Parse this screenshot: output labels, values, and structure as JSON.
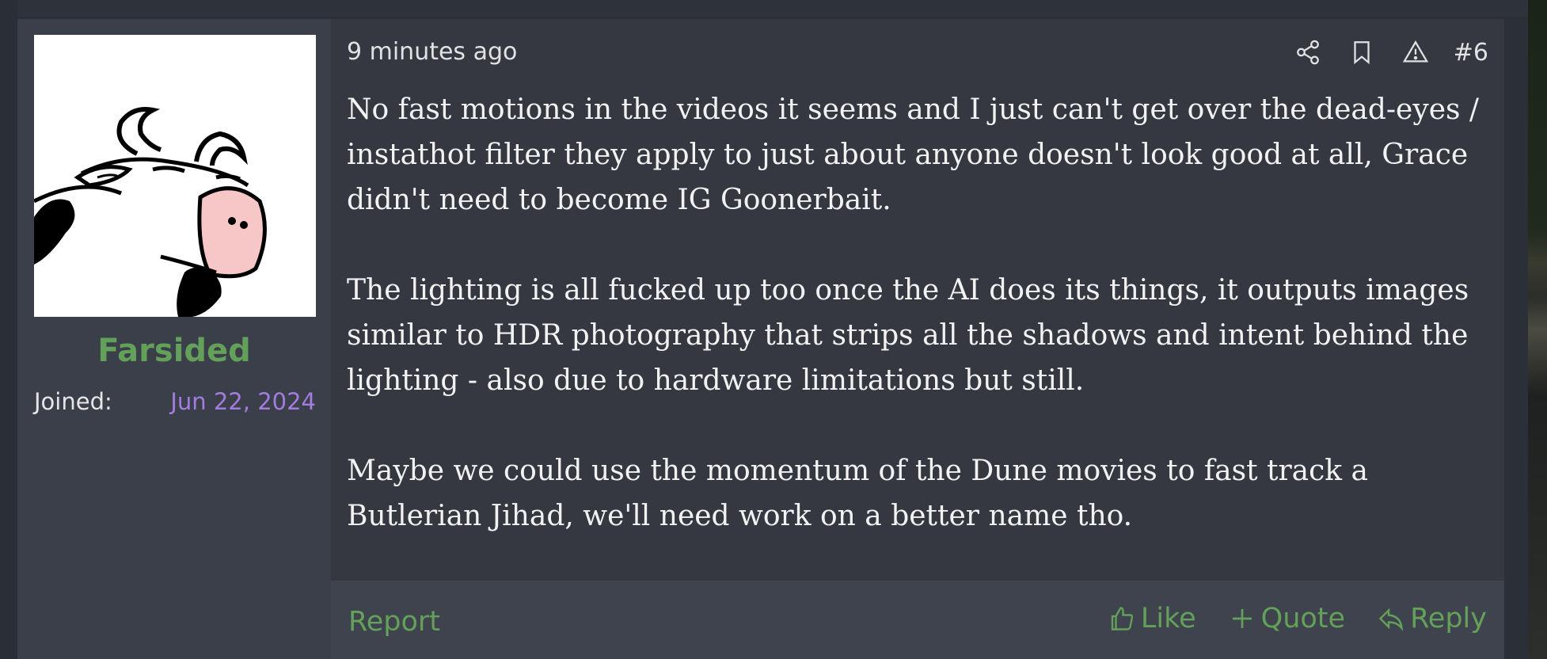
{
  "post": {
    "author": {
      "username": "Farsided",
      "joined_label": "Joined:",
      "joined_date": "Jun 22, 2024",
      "avatar_icon": "cartoon-cow-avatar"
    },
    "meta": {
      "time": "9 minutes ago",
      "post_number": "#6",
      "icons": [
        "share-icon",
        "bookmark-icon",
        "warning-icon"
      ]
    },
    "body": {
      "paragraphs": [
        "No fast motions in the videos it seems and I just can't get over the dead-eyes / instathot filter they apply to just about anyone doesn't look good at all, Grace didn't need to become IG Goonerbait.",
        "The lighting is all fucked up too once the AI does its things, it outputs images similar to HDR photography that strips all the shadows and intent behind the lighting - also due to hardware limitations but still.",
        "Maybe we could use the momentum of the Dune movies to fast track a Butlerian Jihad, we'll need work on a better name tho."
      ]
    },
    "footer": {
      "report_label": "Report",
      "like_label": "Like",
      "quote_label": "Quote",
      "reply_label": "Reply"
    }
  },
  "colors": {
    "accent_green": "#63a05a",
    "join_date_purple": "#a27ce0",
    "post_bg": "#353841",
    "user_bg": "#3b3f49"
  }
}
